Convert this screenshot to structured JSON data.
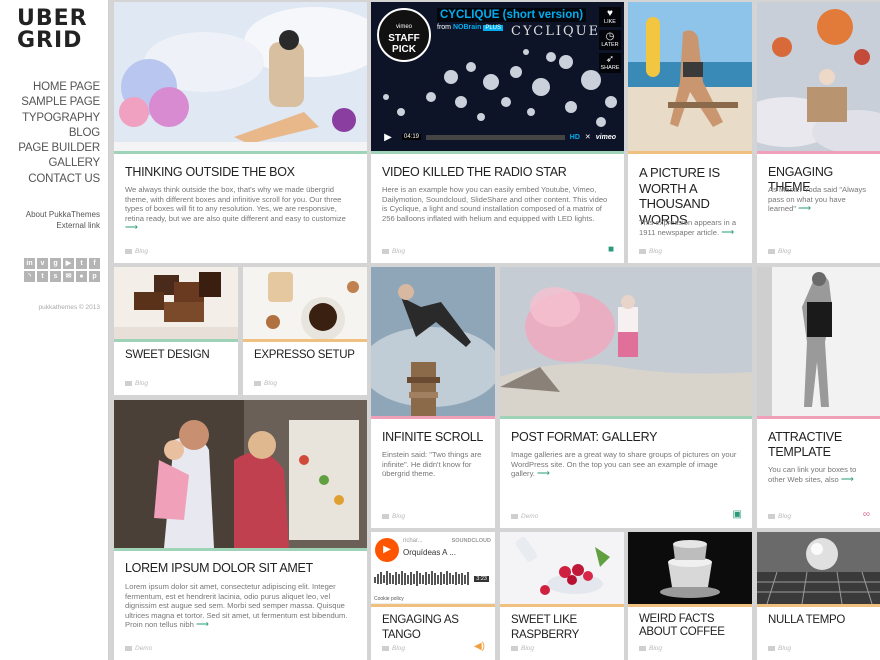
{
  "brand": {
    "logo_line1": "UBER",
    "logo_line2": "GRID"
  },
  "nav": [
    "HOME PAGE",
    "SAMPLE PAGE",
    "TYPOGRAPHY",
    "BLOG",
    "PAGE BUILDER",
    "GALLERY",
    "CONTACT US"
  ],
  "meta_links": [
    "About PukkaThemes",
    "External link"
  ],
  "social_icons": [
    "linkedin-icon",
    "vimeo-icon",
    "googleplus-icon",
    "youtube-icon",
    "twitter-icon",
    "facebook-icon",
    "rss-icon",
    "tumblr-icon",
    "skype-icon",
    "email-icon",
    "flickr-icon",
    "pinterest-icon"
  ],
  "copyright": "pukkathemes © 2013",
  "arrow": "⟶",
  "colors": {
    "teal": "#2a9a7a",
    "pink": "#f0a0b8",
    "green": "#9fd3b8",
    "orange": "#f0c080",
    "vimeo_blue": "#00adef",
    "soundcloud_orange": "#ff5500"
  },
  "video": {
    "title": "CYCLIQUE (short version)",
    "from_prefix": "from",
    "from_user": "NOBrain",
    "plus": "PLUS",
    "badge": "STAFF PICK",
    "badge_brand": "vimeo",
    "like": "LIKE",
    "later": "LATER",
    "share": "SHARE",
    "cyc_text": "CYCLIQUE",
    "time": "04:19",
    "hd": "HD",
    "brand": "vimeo"
  },
  "sound": {
    "user": "richar...",
    "logo": "SOUNDCLOUD",
    "track": "Orquídeas A ...",
    "time": "3:23",
    "cookie": "Cookie policy"
  },
  "cards": {
    "thinking": {
      "title": "THINKING OUTSIDE THE BOX",
      "text": "We always think outside the box, that's why we made übergrid theme, with different boxes and infinitive scroll for you. Our three types of boxes will fit to any resolution. Yes, we are responsive, retina ready, but we are also quite different and easy to customize",
      "category": "Blog"
    },
    "video_killed": {
      "title": "VIDEO KILLED THE RADIO STAR",
      "text": "Here is an example how you can easily embed Youtube, Vimeo, Dailymotion, Soundcloud, SlideShare and other content. This video is Cyclique, a light and sound installation composed of a matrix of 256 balloons inflated with helium and equipped with LED lights.",
      "category": "Blog"
    },
    "picture": {
      "title": "A PICTURE IS WORTH A THOUSAND WORDS",
      "text": "This expression appears in a 1911 newspaper article.",
      "category": "Blog"
    },
    "engaging_theme": {
      "title": "ENGAGING THEME",
      "text": "As Master Yoda said \"Always pass on what you have learned\"",
      "category": "Blog"
    },
    "sweet_design": {
      "title": "SWEET DESIGN",
      "category": "Blog"
    },
    "expresso": {
      "title": "EXPRESSO SETUP",
      "category": "Blog"
    },
    "infinite": {
      "title": "INFINITE SCROLL",
      "text": "Einstein said: \"Two things are infinite\". He didn't know for übergrid theme.",
      "category": "Blog"
    },
    "gallery": {
      "title": "POST FORMAT: GALLERY",
      "text": "Image galleries are a great way to share groups of pictures on your WordPress site. On the top you can see an example of image gallery.",
      "category": "Demo"
    },
    "attractive": {
      "title": "ATTRACTIVE TEMPLATE",
      "text": "You can link your boxes to other Web sites, also",
      "category": "Blog"
    },
    "lorem": {
      "title": "LOREM IPSUM DOLOR SIT AMET",
      "text": "Lorem ipsum dolor sit amet, consectetur adipiscing elit. Integer fermentum, est et hendrerit lacinia, odio purus aliquet leo, vel dignissim est augue sed sem. Morbi sed semper massa. Quisque ultrices magna et tortor. Sed sit amet, ut fermentum est bibendum. Proin non tellus nibh",
      "category": "Demo"
    },
    "tango": {
      "title": "ENGAGING AS TANGO",
      "category": "Blog"
    },
    "raspberry": {
      "title": "SWEET LIKE RASPBERRY",
      "category": "Blog"
    },
    "weird": {
      "title": "WEIRD FACTS ABOUT COFFEE",
      "category": "Blog"
    },
    "nulla": {
      "title": "NULLA TEMPO",
      "category": "Blog"
    }
  }
}
